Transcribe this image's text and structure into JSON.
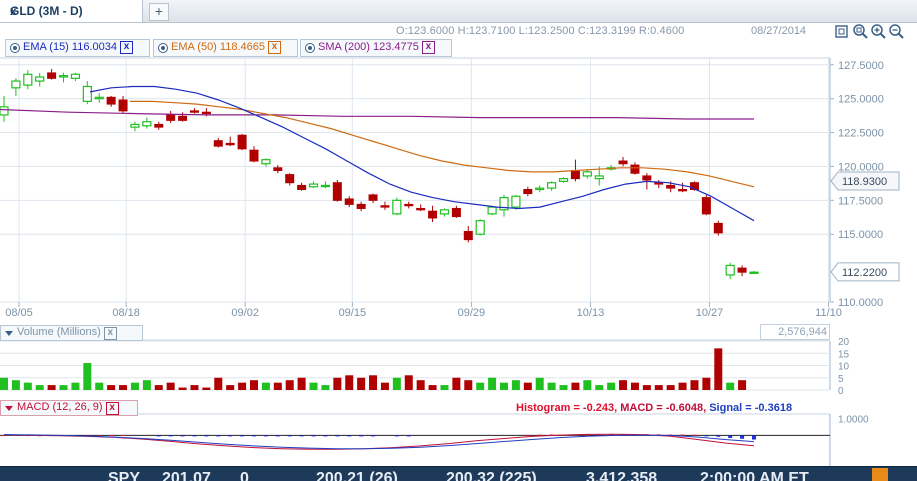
{
  "tab": {
    "title": "GLD  (3M - D)",
    "close_glyph": "x",
    "add_glyph": "+"
  },
  "ohlc": {
    "text": "O:123.6000  H:123.7100  L:123.2500  C:123.3199  R:0.4600"
  },
  "date_stamp": "08/27/2014",
  "indicators": [
    {
      "label": "EMA (15) 116.0034",
      "color": "#1b2bbf"
    },
    {
      "label": "EMA (50) 118.4665",
      "color": "#d06a10"
    },
    {
      "label": "SMA (200) 123.4775",
      "color": "#8a1e8a"
    }
  ],
  "close_glyph": "x",
  "toolbar_icons": [
    "window-icon",
    "zoom-fit-icon",
    "zoom-in-icon",
    "zoom-out-icon"
  ],
  "price_axis": {
    "ticks": [
      "127.5000",
      "125.0000",
      "122.5000",
      "120.0000",
      "117.5000",
      "115.0000",
      "110.0000"
    ],
    "marker_upper": "118.9300",
    "marker_last": "112.2200"
  },
  "date_axis": {
    "ticks": [
      "08/05",
      "08/18",
      "09/02",
      "09/15",
      "09/29",
      "10/13",
      "10/27",
      "11/10"
    ]
  },
  "volume_panel": {
    "title": "Volume (Millions)",
    "readout": "2,576,944",
    "ticks": [
      "20",
      "15",
      "10",
      "5",
      "0"
    ]
  },
  "macd_panel": {
    "title": "MACD (12, 26, 9)",
    "histogram_label": "Histogram = -0.243",
    "separator": ",",
    "macd_label": "MACD = -0.6048",
    "signal_label": "Signal = -0.3618",
    "tick": "1.0000"
  },
  "bottom_strip": {
    "items": [
      "SPY",
      "201.07",
      "0",
      "200.21 (26)",
      "200.32 (225)",
      "3,412,358",
      "2:00:00 AM ET"
    ]
  },
  "colors": {
    "up": "#1fc01f",
    "down": "#b00000",
    "grid": "#dfe6ee",
    "axis_text": "#7d93a8",
    "ema15": "#1b2bbf",
    "ema50": "#d06a10",
    "sma200": "#8a1e8a",
    "histogram_pos": "#e01030",
    "histogram_neg": "#2030e0",
    "macd_line": "#c0103a",
    "signal_line": "#2040c0"
  },
  "chart_data": {
    "type": "candlestick",
    "ylim": [
      110,
      128
    ],
    "ohlc": [
      {
        "o": 123.8,
        "h": 125.2,
        "l": 123.3,
        "c": 124.4
      },
      {
        "o": 125.8,
        "h": 126.5,
        "l": 125.2,
        "c": 126.3
      },
      {
        "o": 126.0,
        "h": 127.1,
        "l": 125.7,
        "c": 126.8
      },
      {
        "o": 126.3,
        "h": 126.9,
        "l": 125.9,
        "c": 126.6
      },
      {
        "o": 126.9,
        "h": 127.2,
        "l": 126.4,
        "c": 126.5
      },
      {
        "o": 126.6,
        "h": 126.9,
        "l": 126.2,
        "c": 126.7
      },
      {
        "o": 126.5,
        "h": 126.9,
        "l": 126.3,
        "c": 126.8
      },
      {
        "o": 124.8,
        "h": 126.3,
        "l": 124.6,
        "c": 125.9
      },
      {
        "o": 125.0,
        "h": 125.4,
        "l": 124.7,
        "c": 125.1
      },
      {
        "o": 125.1,
        "h": 125.2,
        "l": 124.4,
        "c": 124.6
      },
      {
        "o": 124.9,
        "h": 125.2,
        "l": 123.9,
        "c": 124.1
      },
      {
        "o": 122.9,
        "h": 123.3,
        "l": 122.6,
        "c": 123.1
      },
      {
        "o": 123.0,
        "h": 123.6,
        "l": 122.8,
        "c": 123.3
      },
      {
        "o": 123.1,
        "h": 123.3,
        "l": 122.7,
        "c": 122.9
      },
      {
        "o": 123.8,
        "h": 124.1,
        "l": 123.2,
        "c": 123.4
      },
      {
        "o": 123.7,
        "h": 124.0,
        "l": 123.3,
        "c": 123.4
      },
      {
        "o": 124.1,
        "h": 124.3,
        "l": 123.9,
        "c": 124.0
      },
      {
        "o": 124.0,
        "h": 124.3,
        "l": 123.7,
        "c": 123.9
      },
      {
        "o": 121.9,
        "h": 122.1,
        "l": 121.4,
        "c": 121.5
      },
      {
        "o": 121.7,
        "h": 122.2,
        "l": 121.5,
        "c": 121.6
      },
      {
        "o": 122.3,
        "h": 122.4,
        "l": 121.2,
        "c": 121.3
      },
      {
        "o": 121.2,
        "h": 121.5,
        "l": 120.3,
        "c": 120.4
      },
      {
        "o": 120.2,
        "h": 120.6,
        "l": 120.0,
        "c": 120.5
      },
      {
        "o": 119.9,
        "h": 120.1,
        "l": 119.5,
        "c": 119.7
      },
      {
        "o": 119.4,
        "h": 119.5,
        "l": 118.6,
        "c": 118.8
      },
      {
        "o": 118.6,
        "h": 118.8,
        "l": 118.2,
        "c": 118.3
      },
      {
        "o": 118.5,
        "h": 118.9,
        "l": 118.4,
        "c": 118.7
      },
      {
        "o": 118.6,
        "h": 118.9,
        "l": 118.4,
        "c": 118.6
      },
      {
        "o": 118.8,
        "h": 119.0,
        "l": 117.4,
        "c": 117.5
      },
      {
        "o": 117.6,
        "h": 117.8,
        "l": 117.0,
        "c": 117.2
      },
      {
        "o": 117.2,
        "h": 117.4,
        "l": 116.7,
        "c": 116.9
      },
      {
        "o": 117.9,
        "h": 118.0,
        "l": 117.3,
        "c": 117.5
      },
      {
        "o": 117.1,
        "h": 117.4,
        "l": 116.8,
        "c": 117.0
      },
      {
        "o": 116.5,
        "h": 117.7,
        "l": 116.4,
        "c": 117.5
      },
      {
        "o": 117.2,
        "h": 117.4,
        "l": 116.9,
        "c": 117.1
      },
      {
        "o": 116.9,
        "h": 117.2,
        "l": 116.7,
        "c": 116.8
      },
      {
        "o": 116.7,
        "h": 117.1,
        "l": 115.9,
        "c": 116.2
      },
      {
        "o": 116.5,
        "h": 116.9,
        "l": 116.3,
        "c": 116.8
      },
      {
        "o": 116.9,
        "h": 117.1,
        "l": 116.2,
        "c": 116.3
      },
      {
        "o": 115.2,
        "h": 115.6,
        "l": 114.4,
        "c": 114.6
      },
      {
        "o": 115.0,
        "h": 116.1,
        "l": 114.9,
        "c": 116.0
      },
      {
        "o": 116.5,
        "h": 117.1,
        "l": 116.4,
        "c": 117.0
      },
      {
        "o": 116.8,
        "h": 117.9,
        "l": 116.3,
        "c": 117.7
      },
      {
        "o": 117.0,
        "h": 117.9,
        "l": 116.8,
        "c": 117.8
      },
      {
        "o": 118.3,
        "h": 118.5,
        "l": 117.8,
        "c": 118.0
      },
      {
        "o": 118.3,
        "h": 118.6,
        "l": 118.1,
        "c": 118.4
      },
      {
        "o": 118.4,
        "h": 118.9,
        "l": 118.2,
        "c": 118.8
      },
      {
        "o": 118.9,
        "h": 119.2,
        "l": 118.8,
        "c": 119.1
      },
      {
        "o": 119.7,
        "h": 120.5,
        "l": 118.9,
        "c": 119.1
      },
      {
        "o": 119.3,
        "h": 119.8,
        "l": 119.1,
        "c": 119.6
      },
      {
        "o": 119.1,
        "h": 120.0,
        "l": 118.6,
        "c": 119.3
      },
      {
        "o": 119.9,
        "h": 120.1,
        "l": 119.7,
        "c": 119.9
      },
      {
        "o": 120.4,
        "h": 120.7,
        "l": 120.0,
        "c": 120.2
      },
      {
        "o": 120.1,
        "h": 120.3,
        "l": 119.4,
        "c": 119.5
      },
      {
        "o": 119.3,
        "h": 119.5,
        "l": 118.3,
        "c": 119.0
      },
      {
        "o": 118.8,
        "h": 119.0,
        "l": 118.4,
        "c": 118.7
      },
      {
        "o": 118.6,
        "h": 118.9,
        "l": 118.1,
        "c": 118.4
      },
      {
        "o": 118.3,
        "h": 118.8,
        "l": 118.1,
        "c": 118.2
      },
      {
        "o": 118.8,
        "h": 118.9,
        "l": 118.2,
        "c": 118.3
      },
      {
        "o": 117.7,
        "h": 117.9,
        "l": 116.4,
        "c": 116.5
      },
      {
        "o": 115.8,
        "h": 116.0,
        "l": 114.9,
        "c": 115.1
      },
      {
        "o": 112.0,
        "h": 112.9,
        "l": 111.7,
        "c": 112.7
      },
      {
        "o": 112.5,
        "h": 112.7,
        "l": 111.9,
        "c": 112.2
      },
      {
        "o": 112.2,
        "h": 112.3,
        "l": 112.1,
        "c": 112.2
      }
    ],
    "ema15": [
      125.5,
      125.8,
      125.9,
      125.9,
      125.7,
      125.4,
      124.9,
      124.3,
      123.6,
      122.9,
      122.1,
      121.3,
      120.4,
      119.5,
      118.7,
      118.1,
      117.7,
      117.4,
      117.2,
      117.0,
      116.9,
      117.0,
      117.4,
      117.8,
      118.3,
      118.7,
      118.9,
      118.8,
      118.5,
      117.8,
      116.9,
      116.0
    ],
    "ema50": [
      124.8,
      124.8,
      124.7,
      124.6,
      124.4,
      124.2,
      123.9,
      123.6,
      123.2,
      122.8,
      122.3,
      121.8,
      121.3,
      120.8,
      120.4,
      120.1,
      119.9,
      119.7,
      119.6,
      119.6,
      119.7,
      119.8,
      119.9,
      119.9,
      119.8,
      119.6,
      119.3,
      118.9,
      118.5
    ],
    "sma200": [
      124.2,
      124.0,
      123.9,
      123.8,
      123.8,
      123.7,
      123.7,
      123.6,
      123.6,
      123.6,
      123.5,
      123.5
    ],
    "volume": [
      5,
      4,
      3,
      2,
      2,
      2,
      3,
      11,
      3,
      2,
      2,
      3,
      4,
      2,
      3,
      1,
      2,
      1,
      5,
      2,
      3,
      4,
      3,
      3,
      4,
      5,
      3,
      2,
      5,
      6,
      5,
      6,
      3,
      5,
      6,
      4,
      2,
      2,
      5,
      4,
      3,
      5,
      3,
      4,
      3,
      5,
      3,
      2,
      3,
      4,
      2,
      3,
      4,
      3,
      2,
      2,
      2,
      3,
      4,
      5,
      17,
      3,
      4
    ],
    "volume_ylim": [
      0,
      20
    ],
    "macd_histogram": [
      0.02,
      0.03,
      0.02,
      0.01,
      0.02,
      0.02,
      0.01,
      0.01,
      0.01,
      0.02,
      0.03,
      0.0,
      0.0,
      -0.02,
      -0.03,
      -0.04,
      -0.04,
      -0.05,
      -0.05,
      -0.04,
      -0.04,
      -0.05,
      -0.05,
      -0.04,
      -0.03,
      -0.03,
      -0.04,
      -0.02,
      -0.02,
      -0.04,
      -0.03,
      -0.02,
      0.0,
      -0.01,
      -0.03,
      0.0,
      0.0,
      0.0,
      0.0,
      0.0,
      0.0,
      0.0,
      0.0,
      0.0,
      0.03,
      0.04,
      0.05,
      0.05,
      0.06,
      0.06,
      0.07,
      0.07,
      0.07,
      0.07,
      0.07,
      0.06,
      0.05,
      0.05,
      0.04,
      -0.03,
      -0.08,
      -0.15,
      -0.2,
      -0.243
    ],
    "macd_line": [
      0.05,
      0.0,
      -0.02,
      -0.06,
      -0.12,
      -0.22,
      -0.35,
      -0.5,
      -0.62,
      -0.72,
      -0.78,
      -0.82,
      -0.82,
      -0.78,
      -0.72,
      -0.62,
      -0.48,
      -0.32,
      -0.18,
      -0.06,
      0.02,
      0.06,
      0.07,
      0.05,
      -0.05,
      -0.25,
      -0.45,
      -0.6048
    ],
    "signal_line": [
      0.05,
      0.03,
      0.0,
      -0.04,
      -0.1,
      -0.18,
      -0.28,
      -0.4,
      -0.52,
      -0.62,
      -0.7,
      -0.75,
      -0.78,
      -0.78,
      -0.76,
      -0.7,
      -0.6,
      -0.48,
      -0.36,
      -0.24,
      -0.13,
      -0.05,
      0.0,
      0.02,
      0.0,
      -0.1,
      -0.25,
      -0.3618
    ],
    "macd_ylim": [
      -1.8,
      1.2
    ]
  }
}
